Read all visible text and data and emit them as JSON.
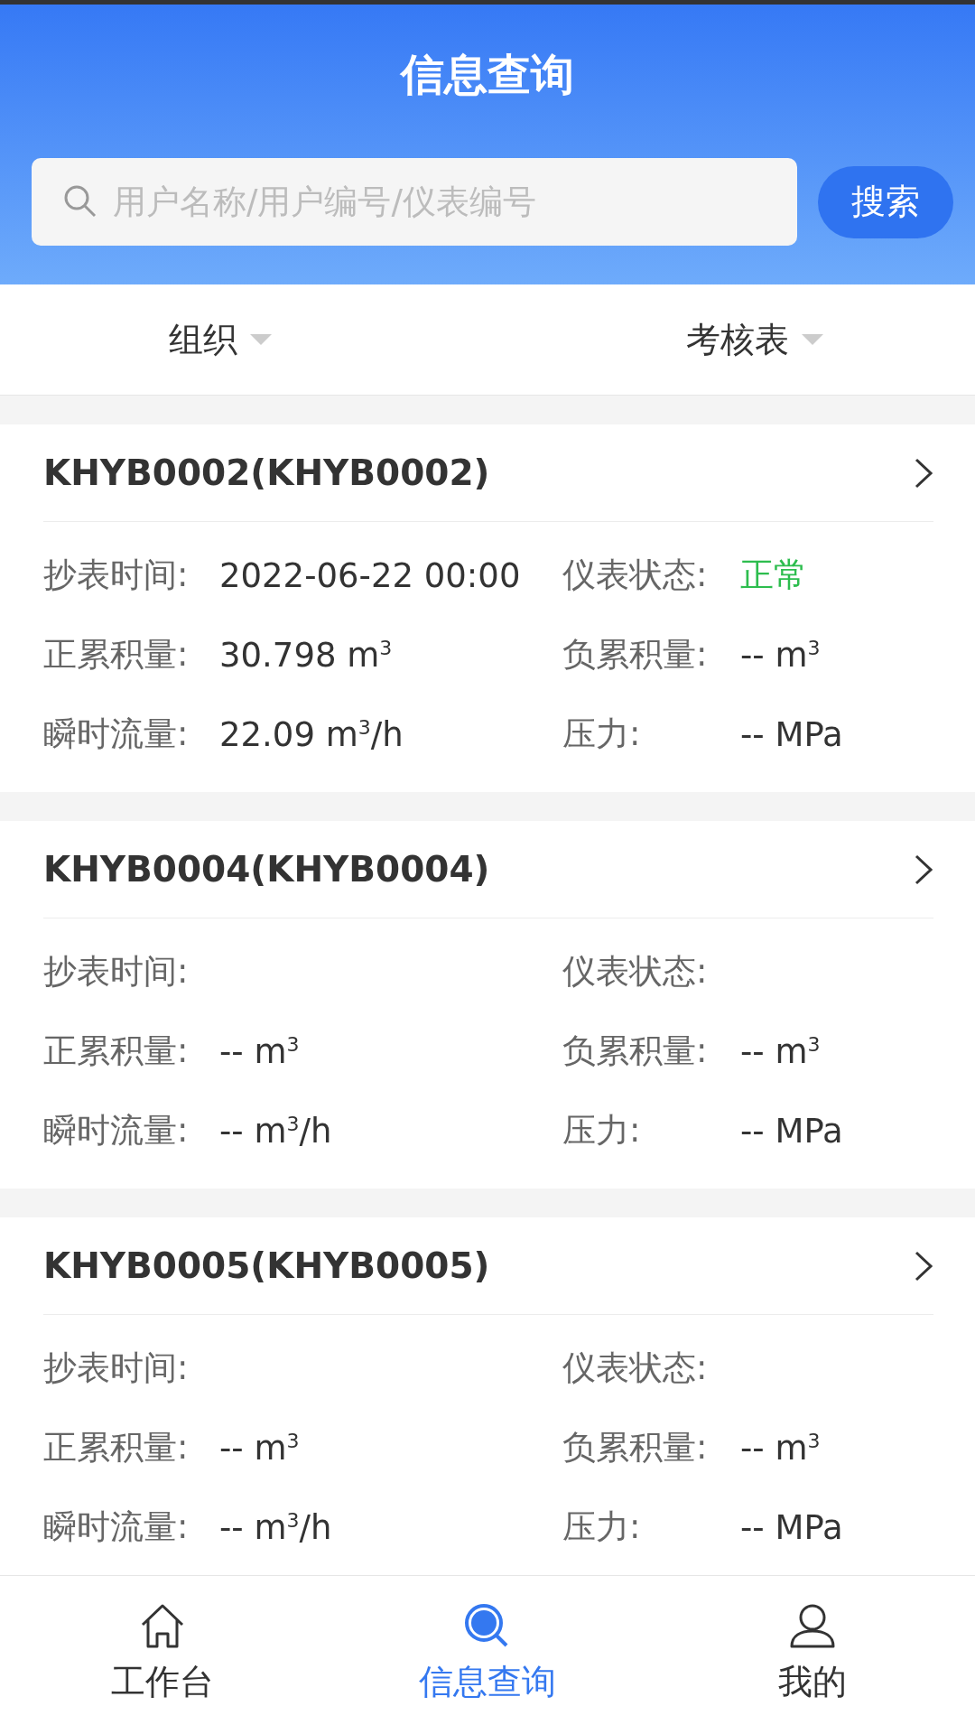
{
  "header": {
    "title": "信息查询"
  },
  "search": {
    "placeholder": "用户名称/用户编号/仪表编号",
    "button": "搜索"
  },
  "filters": [
    {
      "label": "组织"
    },
    {
      "label": "考核表"
    }
  ],
  "meters": [
    {
      "title": "KHYB0002(KHYB0002)",
      "fields": [
        {
          "label": "抄表时间:",
          "value": "2022-06-22 00:00"
        },
        {
          "label": "仪表状态:",
          "value": "正常",
          "color": "#2dbd4e"
        },
        {
          "label": "正累积量:",
          "value": "30.798 m$^{3}$"
        },
        {
          "label": "负累积量:",
          "value": "-- m$^{3}$"
        },
        {
          "label": "瞬时流量:",
          "value": "22.09 m$^{3}$/h"
        },
        {
          "label": "压力:",
          "value": "-- MPa"
        }
      ]
    },
    {
      "title": "KHYB0004(KHYB0004)",
      "fields": [
        {
          "label": "抄表时间:"
        },
        {
          "label": "仪表状态:"
        },
        {
          "label": "正累积量:",
          "value": "-- m$^{3}$"
        },
        {
          "label": "负累积量:",
          "value": "-- m$^{3}$"
        },
        {
          "label": "瞬时流量:",
          "value": "-- m$^{3}$/h"
        },
        {
          "label": "压力:",
          "value": "-- MPa"
        }
      ]
    },
    {
      "title": "KHYB0005(KHYB0005)",
      "fields": [
        {
          "label": "抄表时间:"
        },
        {
          "label": "仪表状态:"
        },
        {
          "label": "正累积量:",
          "value": "-- m$^{3}$"
        },
        {
          "label": "负累积量:",
          "value": "-- m$^{3}$"
        },
        {
          "label": "瞬时流量:",
          "value": "-- m$^{3}$/h"
        },
        {
          "label": "压力:",
          "value": "-- MPa"
        }
      ]
    }
  ],
  "tabbar": [
    {
      "kind": "home",
      "label": "工作台",
      "selected": false
    },
    {
      "kind": "search",
      "label": "信息查询",
      "selected": true
    },
    {
      "kind": "user",
      "label": "我的",
      "selected": false
    }
  ]
}
